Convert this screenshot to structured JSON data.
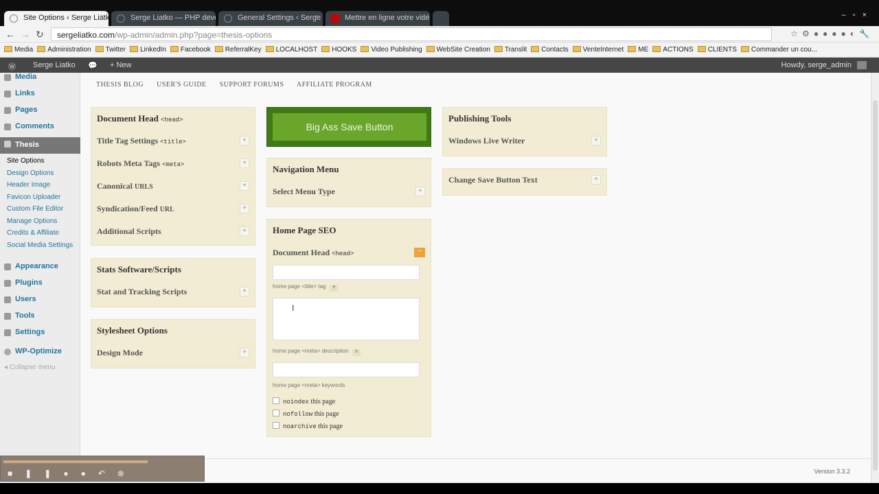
{
  "browser": {
    "tabs": [
      {
        "label": "Site Options ‹ Serge Liatko"
      },
      {
        "label": "Serge Liatko — PHP develo"
      },
      {
        "label": "General Settings ‹ Serge Li"
      },
      {
        "label": "Mettre en ligne votre vidéo"
      }
    ],
    "url_host": "sergeliatko.com",
    "url_path": "/wp-admin/admin.php?page=thesis-options",
    "bookmarks": [
      "Media",
      "Administration",
      "Twitter",
      "LinkedIn",
      "Facebook",
      "ReferralKey",
      "LOCALHOST",
      "HOOKS",
      "Video Publishing",
      "WebSite Creation",
      "Translit",
      "Contacts",
      "VenteInternet",
      "ME",
      "ACTIONS",
      "CLIENTS",
      "Commander un cou..."
    ]
  },
  "adminbar": {
    "site": "Serge Liatko",
    "new": "+ New",
    "howdy": "Howdy, serge_admin"
  },
  "menu": {
    "items": [
      "Media",
      "Links",
      "Pages",
      "Comments",
      "Thesis",
      "Appearance",
      "Plugins",
      "Users",
      "Tools",
      "Settings",
      "WP-Optimize"
    ],
    "submenu": [
      "Site Options",
      "Design Options",
      "Header Image",
      "Favicon Uploader",
      "Custom File Editor",
      "Manage Options",
      "Credits & Affiliate",
      "Social Media Settings"
    ],
    "collapse": "Collapse menu"
  },
  "topnav": [
    "THESIS BLOG",
    "USER'S GUIDE",
    "SUPPORT FORUMS",
    "AFFILIATE PROGRAM"
  ],
  "col1": {
    "doc_head": {
      "title": "Document Head",
      "tag": "<head>",
      "rows": [
        {
          "label": "Title Tag Settings",
          "code": "<title>"
        },
        {
          "label": "Robots Meta Tags",
          "code": "<meta>"
        },
        {
          "label": "Canonical",
          "small": "URLS"
        },
        {
          "label": "Syndication/Feed",
          "small": "URL"
        },
        {
          "label": "Additional Scripts"
        }
      ]
    },
    "stats": {
      "title": "Stats Software/Scripts",
      "row": "Stat and Tracking Scripts"
    },
    "stylesheet": {
      "title": "Stylesheet Options",
      "row": "Design Mode"
    }
  },
  "col2": {
    "save_button": "Big Ass Save Button",
    "nav": {
      "title": "Navigation Menu",
      "row": "Select Menu Type"
    },
    "home": {
      "title": "Home Page SEO",
      "subhead": "Document Head",
      "subtag": "<head>",
      "hint_title": "home page <title> tag",
      "hint_desc": "home page <meta> description",
      "hint_kw": "home page <meta> keywords",
      "hint_e": "e",
      "checks": [
        {
          "code": "noindex",
          "text": " this page"
        },
        {
          "code": "nofollow",
          "text": " this page"
        },
        {
          "code": "noarchive",
          "text": " this page"
        }
      ]
    }
  },
  "col3": {
    "publishing": {
      "title": "Publishing Tools",
      "row": "Windows Live Writer"
    },
    "change_save": "Change Save Button Text"
  },
  "plus": "+",
  "minus": "−",
  "version": "Version 3.3.2"
}
